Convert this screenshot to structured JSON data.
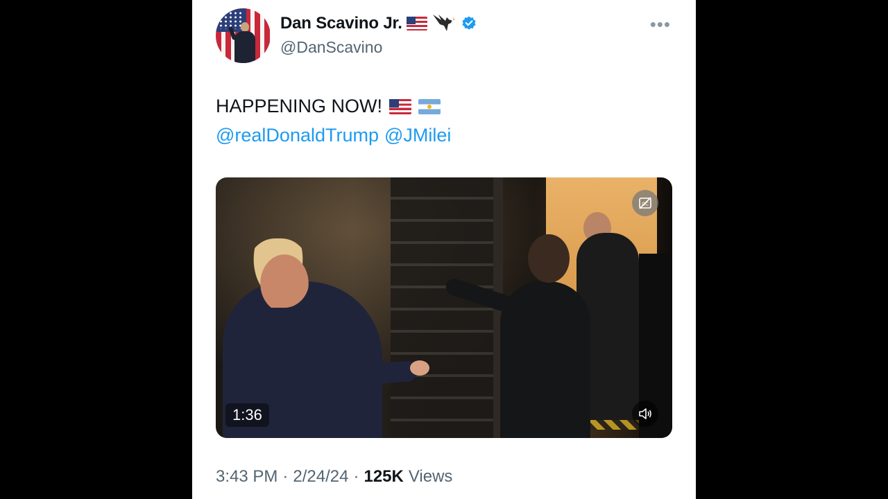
{
  "author": {
    "display_name": "Dan Scavino Jr.",
    "handle": "@DanScavino",
    "verified": true,
    "avatar": "avatar-image",
    "name_emojis": [
      "us-flag-icon",
      "eagle-icon"
    ]
  },
  "tweet": {
    "text": "HAPPENING NOW!",
    "text_emojis": [
      "us-flag-icon",
      "argentina-flag-icon"
    ],
    "mentions": [
      "@realDonaldTrump",
      "@JMilei"
    ]
  },
  "media": {
    "type": "video",
    "duration": "1:36",
    "icons": [
      "captions-off-icon",
      "volume-icon"
    ]
  },
  "meta": {
    "time": "3:43 PM",
    "separator": "·",
    "date": "2/24/24",
    "views_count": "125K",
    "views_label": "Views"
  },
  "colors": {
    "link": "#1d9bf0",
    "verified": "#1d9bf0",
    "text_primary": "#0f1419",
    "text_secondary": "#536471"
  }
}
